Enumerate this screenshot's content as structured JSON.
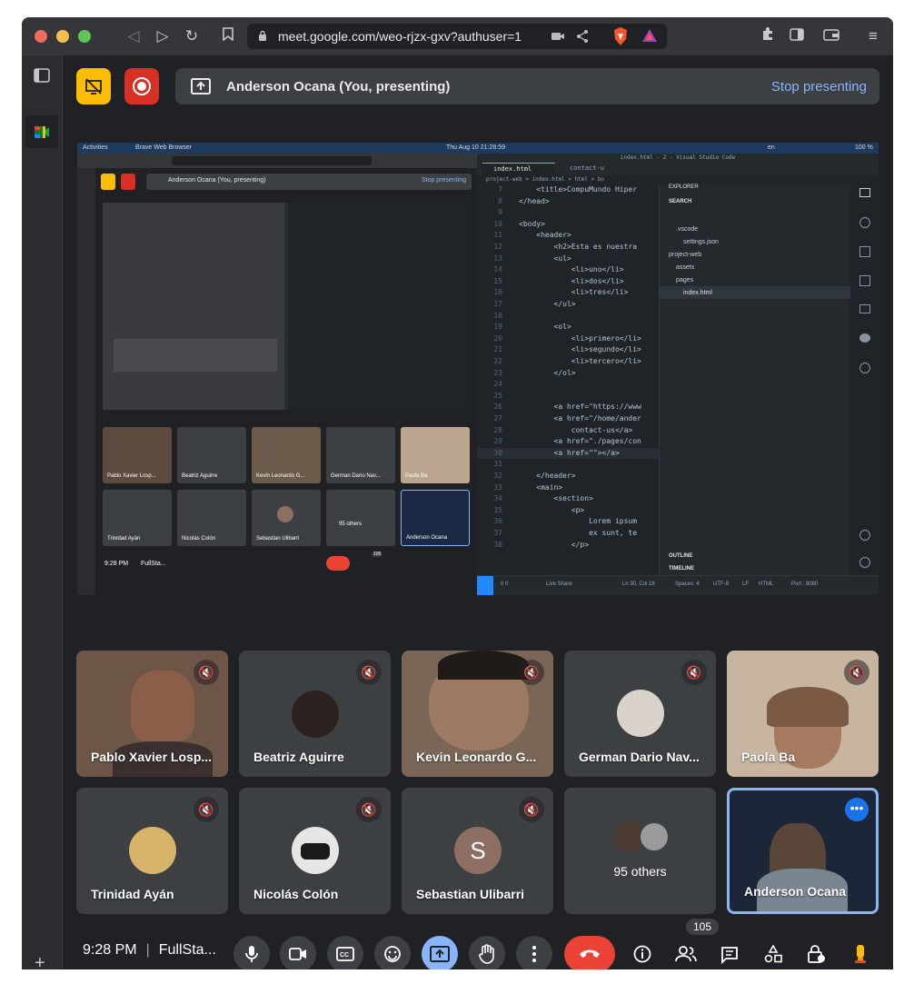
{
  "browser": {
    "url": "meet.google.com/weo-rjzx-gxv?authuser=1"
  },
  "banner": {
    "label": "Anderson Ocana (You, presenting)",
    "stop": "Stop presenting"
  },
  "screen": {
    "topbar": {
      "activities": "Activities",
      "app": "Brave Web Browser",
      "clock": "Thu Aug 10  21:28:59",
      "lang": "en",
      "battery": "100 %"
    },
    "mini_banner": {
      "label": "Anderson Ocana (You, presenting)",
      "stop": "Stop presenting"
    },
    "mini_tiles": [
      {
        "name": "Pablo Xavier Losp..."
      },
      {
        "name": "Beatriz Aguirre"
      },
      {
        "name": "Kevin Leonardo G..."
      },
      {
        "name": "German Dario Nav..."
      },
      {
        "name": "Paola Ba"
      },
      {
        "name": "Trinidad Ayán"
      },
      {
        "name": "Nicolás Colón"
      },
      {
        "name": "Sebastian Ulibarri"
      },
      {
        "name": "95 others"
      },
      {
        "name": "Anderson Ocana"
      }
    ],
    "mini_clock": "9:28 PM",
    "mini_meeting": "FullSta...",
    "mini_count": "105",
    "editor": {
      "title": "index.html - 2 - Visual Studio Code",
      "tabs": [
        "index.html",
        "contact-u"
      ],
      "breadcrumb": "project-web  >  index.html  >  html  >  bo",
      "lines": [
        {
          "n": "7",
          "t": "    <title>CompuMundo Hiper"
        },
        {
          "n": "8",
          "t": "</head>"
        },
        {
          "n": "9",
          "t": ""
        },
        {
          "n": "10",
          "t": "<body>"
        },
        {
          "n": "11",
          "t": "    <header>"
        },
        {
          "n": "12",
          "t": "        <h2>Esta es nuestra"
        },
        {
          "n": "13",
          "t": "        <ul>"
        },
        {
          "n": "14",
          "t": "            <li>uno</li>"
        },
        {
          "n": "15",
          "t": "            <li>dos</li>"
        },
        {
          "n": "16",
          "t": "            <li>tres</li>"
        },
        {
          "n": "17",
          "t": "        </ul>"
        },
        {
          "n": "18",
          "t": ""
        },
        {
          "n": "19",
          "t": "        <ol>"
        },
        {
          "n": "20",
          "t": "            <li>primero</li>"
        },
        {
          "n": "21",
          "t": "            <li>segundo</li>"
        },
        {
          "n": "22",
          "t": "            <li>tercero</li>"
        },
        {
          "n": "23",
          "t": "        </ol>"
        },
        {
          "n": "24",
          "t": ""
        },
        {
          "n": "25",
          "t": ""
        },
        {
          "n": "26",
          "t": "        <a href=\"https://www"
        },
        {
          "n": "27",
          "t": "        <a href=\"/home/ander"
        },
        {
          "n": "28",
          "t": "            contact-us</a>"
        },
        {
          "n": "29",
          "t": "        <a href=\"./pages/con"
        },
        {
          "n": "30",
          "t": "        <a href=\"\"></a>"
        },
        {
          "n": "31",
          "t": ""
        },
        {
          "n": "32",
          "t": "    </header>"
        },
        {
          "n": "33",
          "t": "    <main>"
        },
        {
          "n": "34",
          "t": "        <section>"
        },
        {
          "n": "35",
          "t": "            <p>"
        },
        {
          "n": "36",
          "t": "                Lorem ipsum"
        },
        {
          "n": "37",
          "t": "                ex sunt, te"
        },
        {
          "n": "38",
          "t": "            </p>"
        }
      ],
      "explorer": {
        "header": "EXPLORER",
        "search": "SEARCH",
        "items": [
          ".vscode",
          "settings.json",
          "project-web",
          "assets",
          "pages",
          "index.html"
        ],
        "outline": "OUTLINE",
        "timeline": "TIMELINE"
      },
      "status": {
        "problems": "0  0",
        "live": "Live Share",
        "pos": "Ln 30, Col 18",
        "spaces": "Spaces: 4",
        "enc": "UTF-8",
        "eol": "LF",
        "lang": "HTML",
        "port": "Port : 8080"
      }
    }
  },
  "participants": [
    {
      "name": "Pablo Xavier Losp...",
      "muted": true
    },
    {
      "name": "Beatriz Aguirre",
      "muted": true
    },
    {
      "name": "Kevin Leonardo G...",
      "muted": true
    },
    {
      "name": "German Dario Nav...",
      "muted": true
    },
    {
      "name": "Paola Ba",
      "muted": true
    },
    {
      "name": "Trinidad Ayán",
      "muted": true
    },
    {
      "name": "Nicolás Colón",
      "muted": true
    },
    {
      "name": "Sebastian Ulibarri",
      "muted": true,
      "initial": "S"
    },
    {
      "name": "95 others"
    },
    {
      "name": "Anderson Ocana"
    }
  ],
  "bottom": {
    "clock": "9:28 PM",
    "meeting": "FullSta...",
    "people_count": "105"
  },
  "colors": {
    "accent": "#8ab4f8",
    "hangup": "#ea4335",
    "record": "#d93025",
    "present_badge": "#fbbc04",
    "tile": "#3c4043",
    "background": "#202124"
  }
}
